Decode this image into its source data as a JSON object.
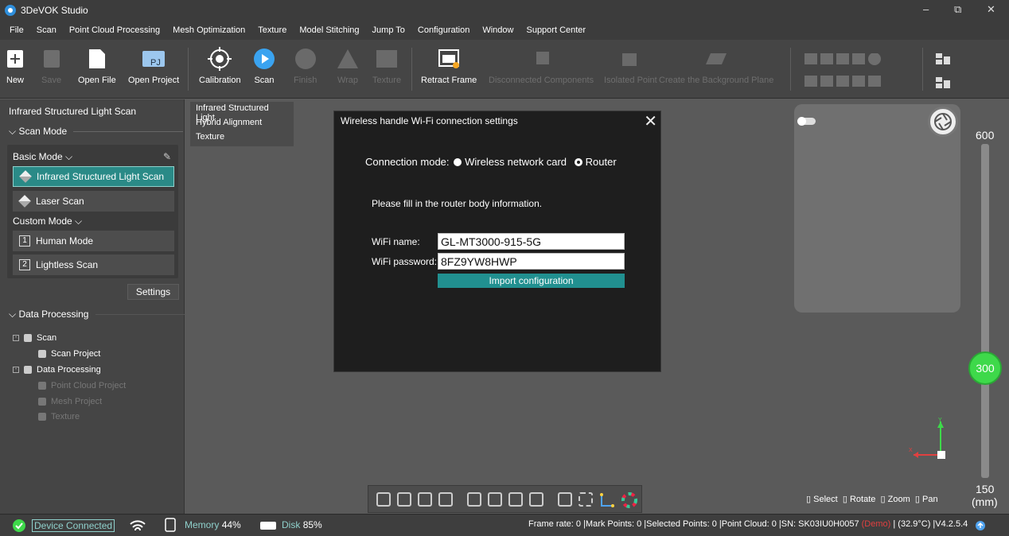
{
  "window": {
    "title": "3DeVOK Studio",
    "min": "–",
    "max": "⧉",
    "close": "✕"
  },
  "menu": [
    "File",
    "Scan",
    "Point Cloud Processing",
    "Mesh Optimization",
    "Texture",
    "Model Stitching",
    "Jump To",
    "Configuration",
    "Window",
    "Support Center"
  ],
  "toolbar": {
    "new": "New",
    "save": "Save",
    "open_file": "Open File",
    "open_project": "Open Project",
    "project_icon_text": "PJ",
    "calibration": "Calibration",
    "scan": "Scan",
    "finish": "Finish",
    "wrap": "Wrap",
    "texture": "Texture",
    "retract_frame": "Retract Frame",
    "disconnected": "Disconnected Components",
    "isolated": "Isolated Point",
    "background_plane": "Create the Background Plane"
  },
  "left": {
    "header": "Infrared Structured Light Scan",
    "scan_mode": "Scan Mode",
    "basic_mode": "Basic Mode",
    "infrared": "Infrared Structured Light Scan",
    "laser": "Laser Scan",
    "custom_mode": "Custom Mode",
    "human_num": "1",
    "human": "Human Mode",
    "lightless_num": "2",
    "lightless": "Lightless Scan",
    "settings": "Settings",
    "data_processing": "Data Processing",
    "tree": {
      "scan": "Scan",
      "scan_project": "Scan Project",
      "data_processing": "Data Processing",
      "point_cloud_project": "Point Cloud Project",
      "mesh_project": "Mesh Project",
      "texture": "Texture"
    }
  },
  "dropdown": [
    "Infrared Structured Light",
    "Hybrid Alignment",
    "Texture"
  ],
  "dialog": {
    "title": "Wireless handle Wi-Fi connection settings",
    "close": "✕",
    "connection_label": "Connection mode:",
    "option1": "Wireless network card",
    "option2": "Router",
    "hint": "Please fill in the router body information.",
    "wifi_name_label": "WiFi name:",
    "wifi_name": "GL-MT3000-915-5G",
    "wifi_password_label": "WiFi password:",
    "wifi_password": "8FZ9YW8HWP",
    "import": "Import configuration"
  },
  "slider": {
    "top": "600",
    "value": "300",
    "bottom": "150",
    "unit": "(mm)"
  },
  "axes": {
    "y": "Y",
    "x": "X"
  },
  "mouse_help": {
    "select": "Select",
    "rotate": "Rotate",
    "zoom": "Zoom",
    "pan": "Pan"
  },
  "status": {
    "device": "Device Connected",
    "memory_label": "Memory",
    "memory": "44%",
    "disk_label": "Disk",
    "disk": "85%",
    "info": "Frame rate: 0 |Mark Points: 0 |Selected Points: 0 |Point Cloud: 0 |SN: SK03IU0H0057",
    "demo": "(Demo)",
    "temp": "| (32.9°C) |V4.2.5.4"
  },
  "colors": {
    "accent": "#2a8a87",
    "knob": "#3ed94a",
    "demo": "#e04040"
  }
}
